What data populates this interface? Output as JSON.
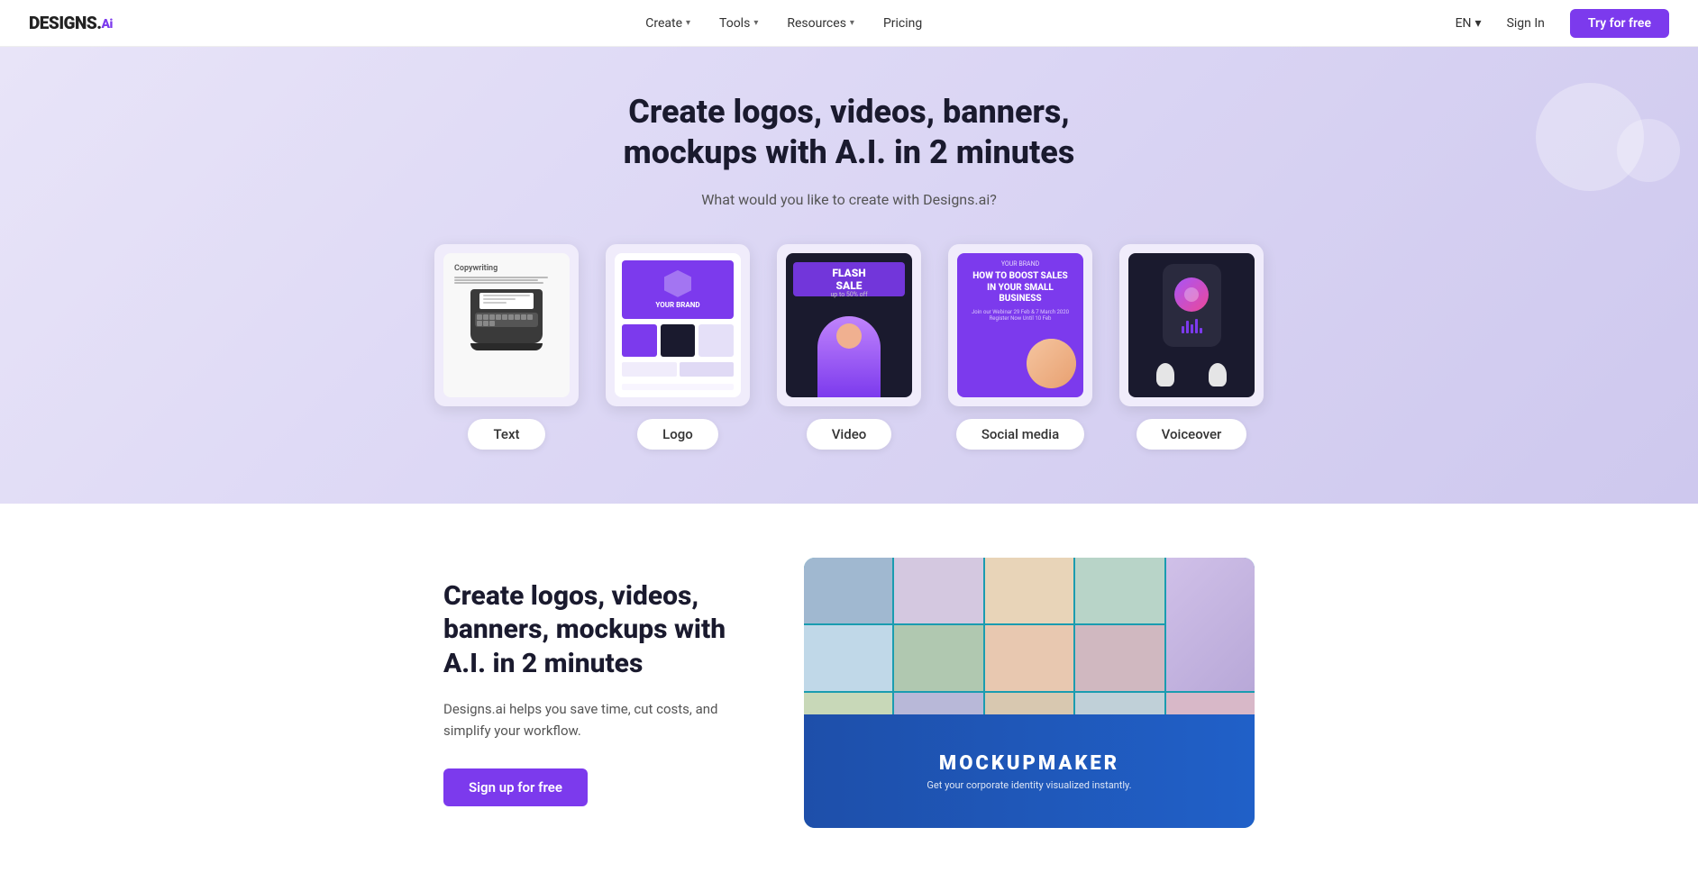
{
  "brand": {
    "name": "DESIGNS.",
    "ai": "Ai",
    "logo_color": "#7c3aed"
  },
  "nav": {
    "links": [
      {
        "label": "Create",
        "has_dropdown": true
      },
      {
        "label": "Tools",
        "has_dropdown": true
      },
      {
        "label": "Resources",
        "has_dropdown": true
      },
      {
        "label": "Pricing",
        "has_dropdown": false
      }
    ],
    "lang": "EN",
    "sign_in": "Sign In",
    "try_free": "Try for free"
  },
  "hero": {
    "title": "Create logos, videos, banners, mockups with A.I. in 2 minutes",
    "subtitle": "What would you like to create with Designs.ai?",
    "tools": [
      {
        "label": "Text"
      },
      {
        "label": "Logo"
      },
      {
        "label": "Video"
      },
      {
        "label": "Social media"
      },
      {
        "label": "Voiceover"
      }
    ]
  },
  "section2": {
    "title": "Create logos, videos, banners, mockups with A.I. in 2 minutes",
    "description": "Designs.ai helps you save time, cut costs, and simplify your workflow.",
    "cta": "Sign up for free",
    "mockup": {
      "title": "MOCKUPMAKER",
      "subtitle": "Get your corporate identity visualized instantly."
    }
  }
}
